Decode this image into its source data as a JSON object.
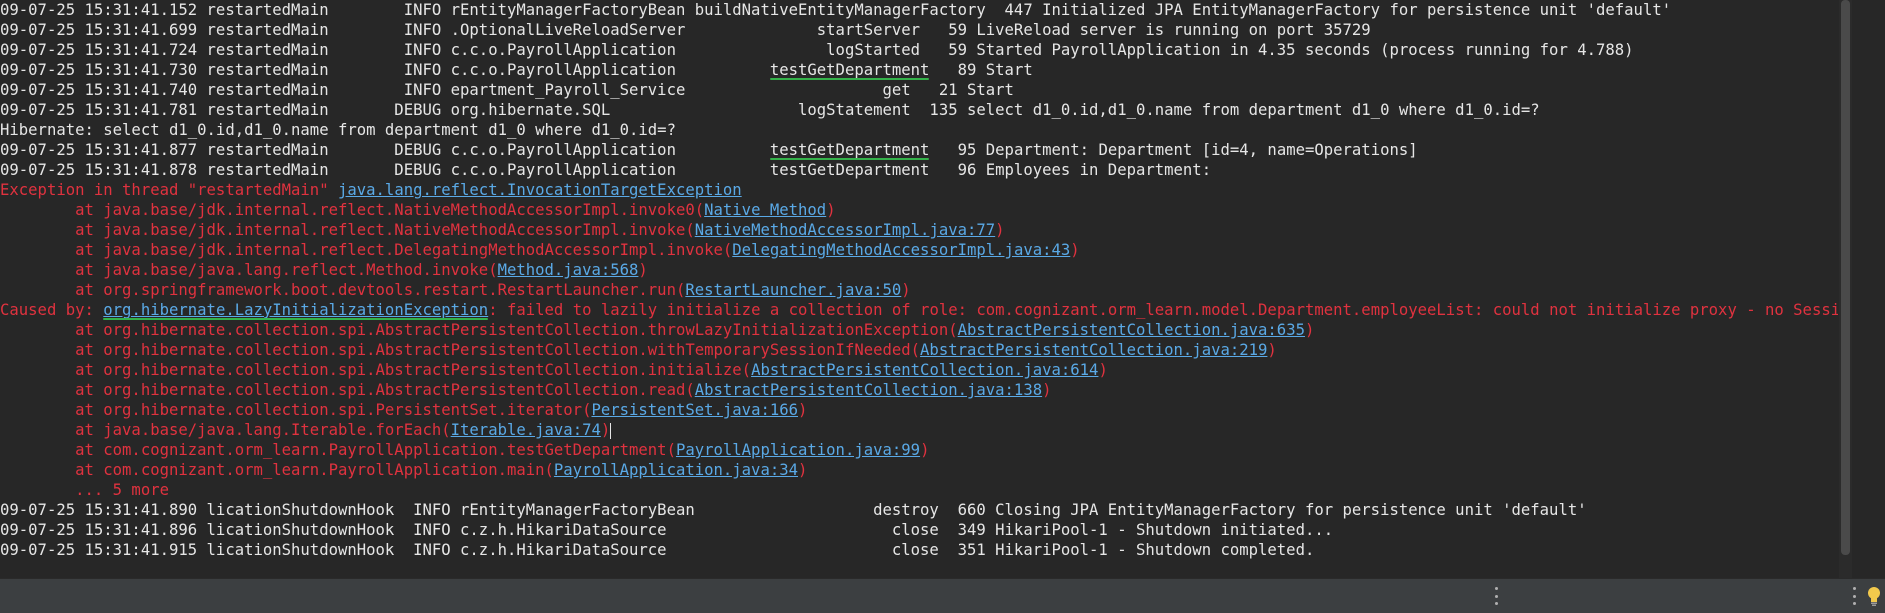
{
  "console": {
    "lines": [
      {
        "segments": [
          {
            "t": "09-07-25 15:31:41.152 restartedMain        INFO rEntityManagerFactoryBean buildNativeEntityManagerFactory  447 Initialized JPA EntityManagerFactory for persistence unit 'default'"
          }
        ]
      },
      {
        "segments": [
          {
            "t": "09-07-25 15:31:41.699 restartedMain        INFO .OptionalLiveReloadServer              startServer   59 LiveReload server is running on port 35729"
          }
        ]
      },
      {
        "segments": [
          {
            "t": "09-07-25 15:31:41.724 restartedMain        INFO c.c.o.PayrollApplication                logStarted   59 Started PayrollApplication in 4.35 seconds (process running for 4.788)"
          }
        ]
      },
      {
        "segments": [
          {
            "t": "09-07-25 15:31:41.730 restartedMain        INFO c.c.o.PayrollApplication          "
          },
          {
            "t": "testGetDepartment",
            "mark": true
          },
          {
            "t": "   89 Start"
          }
        ]
      },
      {
        "segments": [
          {
            "t": "09-07-25 15:31:41.740 restartedMain        INFO epartment_Payroll_Service                     get   21 Start"
          }
        ]
      },
      {
        "segments": [
          {
            "t": "09-07-25 15:31:41.781 restartedMain       DEBUG org.hibernate.SQL                    logStatement  135 select d1_0.id,d1_0.name from department d1_0 where d1_0.id=?"
          }
        ]
      },
      {
        "segments": [
          {
            "t": "Hibernate: select d1_0.id,d1_0.name from department d1_0 where d1_0.id=?"
          }
        ]
      },
      {
        "segments": [
          {
            "t": "09-07-25 15:31:41.877 restartedMain       DEBUG c.c.o.PayrollApplication          "
          },
          {
            "t": "testGetDepartment",
            "mark": true
          },
          {
            "t": "   95 Department: Department [id=4, name=Operations]"
          }
        ]
      },
      {
        "segments": [
          {
            "t": "09-07-25 15:31:41.878 restartedMain       DEBUG c.c.o.PayrollApplication          testGetDepartment   96 Employees in Department:"
          }
        ]
      },
      {
        "segments": [
          {
            "t": "Exception in thread \"restartedMain\" ",
            "cls": "err"
          },
          {
            "t": "java.lang.reflect.InvocationTargetException",
            "cls": "link"
          }
        ]
      },
      {
        "segments": [
          {
            "t": "        at java.base/jdk.internal.reflect.NativeMethodAccessorImpl.invoke0(",
            "cls": "err"
          },
          {
            "t": "Native Method",
            "cls": "link"
          },
          {
            "t": ")",
            "cls": "err"
          }
        ]
      },
      {
        "segments": [
          {
            "t": "        at java.base/jdk.internal.reflect.NativeMethodAccessorImpl.invoke(",
            "cls": "err"
          },
          {
            "t": "NativeMethodAccessorImpl.java:77",
            "cls": "link"
          },
          {
            "t": ")",
            "cls": "err"
          }
        ]
      },
      {
        "segments": [
          {
            "t": "        at java.base/jdk.internal.reflect.DelegatingMethodAccessorImpl.invoke(",
            "cls": "err"
          },
          {
            "t": "DelegatingMethodAccessorImpl.java:43",
            "cls": "link"
          },
          {
            "t": ")",
            "cls": "err"
          }
        ]
      },
      {
        "segments": [
          {
            "t": "        at java.base/java.lang.reflect.Method.invoke(",
            "cls": "err"
          },
          {
            "t": "Method.java:568",
            "cls": "link"
          },
          {
            "t": ")",
            "cls": "err"
          }
        ]
      },
      {
        "segments": [
          {
            "t": "        at org.springframework.boot.devtools.restart.RestartLauncher.run(",
            "cls": "err"
          },
          {
            "t": "RestartLauncher.java:50",
            "cls": "link"
          },
          {
            "t": ")",
            "cls": "err"
          }
        ]
      },
      {
        "segments": [
          {
            "t": "Caused by: ",
            "cls": "err"
          },
          {
            "t": "org.hibernate.LazyInitializationException",
            "cls": "link",
            "mark": true
          },
          {
            "t": ": failed to lazily initialize a collection of role: com.cognizant.orm_learn.model.Department.employeeList: could not initialize proxy - no Session",
            "cls": "err"
          }
        ]
      },
      {
        "segments": [
          {
            "t": "        at org.hibernate.collection.spi.AbstractPersistentCollection.throwLazyInitializationException(",
            "cls": "err"
          },
          {
            "t": "AbstractPersistentCollection.java:635",
            "cls": "link"
          },
          {
            "t": ")",
            "cls": "err"
          }
        ]
      },
      {
        "segments": [
          {
            "t": "        at org.hibernate.collection.spi.AbstractPersistentCollection.withTemporarySessionIfNeeded(",
            "cls": "err"
          },
          {
            "t": "AbstractPersistentCollection.java:219",
            "cls": "link"
          },
          {
            "t": ")",
            "cls": "err"
          }
        ]
      },
      {
        "segments": [
          {
            "t": "        at org.hibernate.collection.spi.AbstractPersistentCollection.initialize(",
            "cls": "err"
          },
          {
            "t": "AbstractPersistentCollection.java:614",
            "cls": "link"
          },
          {
            "t": ")",
            "cls": "err"
          }
        ]
      },
      {
        "segments": [
          {
            "t": "        at org.hibernate.collection.spi.AbstractPersistentCollection.read(",
            "cls": "err"
          },
          {
            "t": "AbstractPersistentCollection.java:138",
            "cls": "link"
          },
          {
            "t": ")",
            "cls": "err"
          }
        ]
      },
      {
        "segments": [
          {
            "t": "        at org.hibernate.collection.spi.PersistentSet.iterator(",
            "cls": "err"
          },
          {
            "t": "PersistentSet.java:166",
            "cls": "link"
          },
          {
            "t": ")",
            "cls": "err"
          }
        ]
      },
      {
        "segments": [
          {
            "t": "        at java.base/java.lang.Iterable.forEach(",
            "cls": "err"
          },
          {
            "t": "Iterable.java:74",
            "cls": "link"
          },
          {
            "t": ")",
            "cls": "err"
          },
          {
            "caret": true
          }
        ]
      },
      {
        "segments": [
          {
            "t": "        at com.cognizant.orm_learn.PayrollApplication.testGetDepartment(",
            "cls": "err"
          },
          {
            "t": "PayrollApplication.java:99",
            "cls": "link"
          },
          {
            "t": ")",
            "cls": "err"
          }
        ]
      },
      {
        "segments": [
          {
            "t": "        at com.cognizant.orm_learn.PayrollApplication.main(",
            "cls": "err"
          },
          {
            "t": "PayrollApplication.java:34",
            "cls": "link"
          },
          {
            "t": ")",
            "cls": "err"
          }
        ]
      },
      {
        "segments": [
          {
            "t": "        ... 5 more",
            "cls": "err"
          }
        ]
      },
      {
        "segments": [
          {
            "t": "09-07-25 15:31:41.890 licationShutdownHook  INFO rEntityManagerFactoryBean                   destroy  660 Closing JPA EntityManagerFactory for persistence unit 'default'"
          }
        ]
      },
      {
        "segments": [
          {
            "t": "09-07-25 15:31:41.896 licationShutdownHook  INFO c.z.h.HikariDataSource                        close  349 HikariPool-1 - Shutdown initiated..."
          }
        ]
      },
      {
        "segments": [
          {
            "t": "09-07-25 15:31:41.915 licationShutdownHook  INFO c.z.h.HikariDataSource                        close  351 HikariPool-1 - Shutdown completed."
          }
        ]
      }
    ]
  },
  "statusbar": {
    "icons": [
      "more-vertical-icon",
      "more-vertical-icon",
      "lightbulb-icon"
    ]
  },
  "colors": {
    "background": "#272727",
    "text": "#e6e6e6",
    "error": "#e0323f",
    "link": "#5aa9e6",
    "highlight_underline": "#34b24a"
  }
}
